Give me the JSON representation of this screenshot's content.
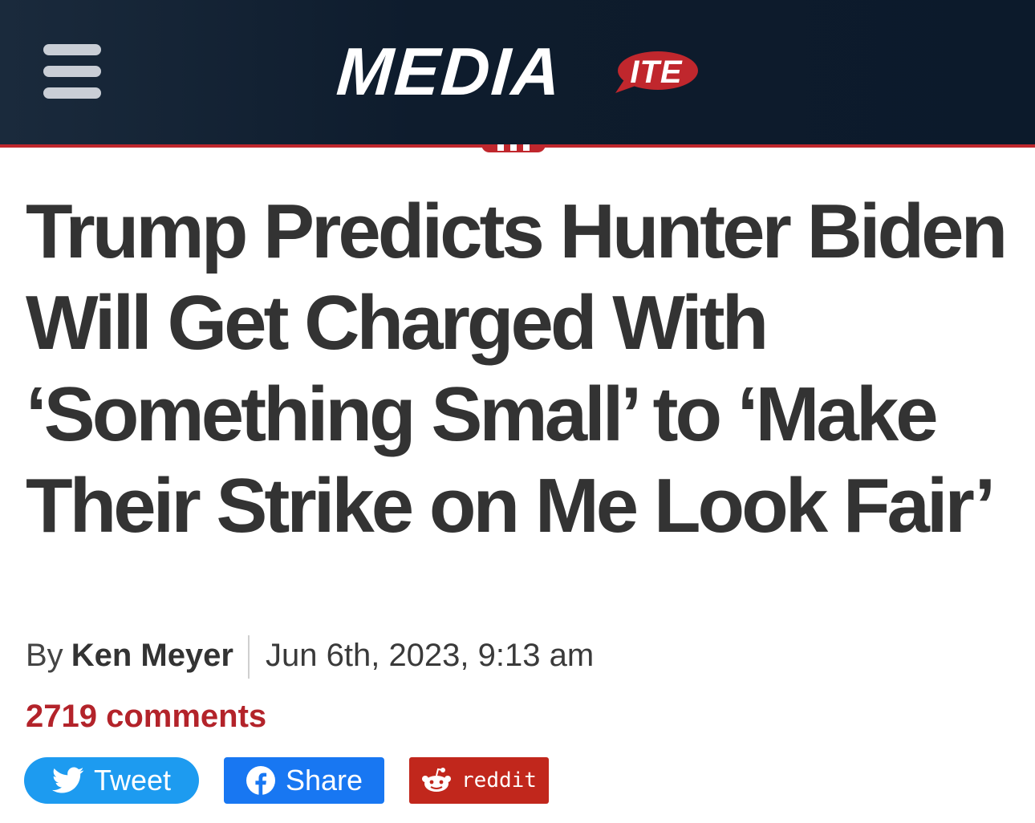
{
  "header": {
    "logo_main": "MEDIA",
    "logo_bubble": "ITE",
    "menu_icon": "hamburger-menu-icon",
    "background_color": "#0f1e2f",
    "accent_color": "#c0272d"
  },
  "article": {
    "headline": "Trump Predicts Hunter Biden Will Get Charged With ‘Something Small’ to ‘Make Their Strike on Me Look Fair’",
    "byline_prefix": "By",
    "author": "Ken Meyer",
    "date": "Jun 6th, 2023, 9:13 am",
    "comments_label": "2719 comments",
    "comments_color": "#b3232a"
  },
  "share": {
    "tweet_label": "Tweet",
    "tweet_icon": "twitter-bird-icon",
    "tweet_color": "#1d9bf0",
    "facebook_label": "Share",
    "facebook_icon": "facebook-icon",
    "facebook_color": "#1877f2",
    "reddit_label": "reddit",
    "reddit_icon": "reddit-alien-icon",
    "reddit_color": "#c1271c"
  }
}
